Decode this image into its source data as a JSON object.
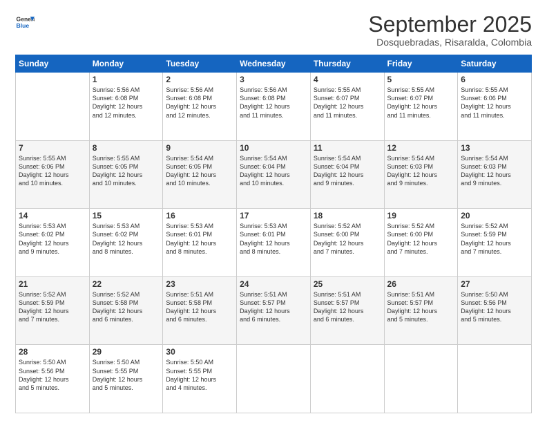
{
  "logo": {
    "line1": "General",
    "line2": "Blue"
  },
  "title": "September 2025",
  "subtitle": "Dosquebradas, Risaralda, Colombia",
  "days_header": [
    "Sunday",
    "Monday",
    "Tuesday",
    "Wednesday",
    "Thursday",
    "Friday",
    "Saturday"
  ],
  "weeks": [
    [
      {
        "num": "",
        "info": ""
      },
      {
        "num": "1",
        "info": "Sunrise: 5:56 AM\nSunset: 6:08 PM\nDaylight: 12 hours\nand 12 minutes."
      },
      {
        "num": "2",
        "info": "Sunrise: 5:56 AM\nSunset: 6:08 PM\nDaylight: 12 hours\nand 12 minutes."
      },
      {
        "num": "3",
        "info": "Sunrise: 5:56 AM\nSunset: 6:08 PM\nDaylight: 12 hours\nand 11 minutes."
      },
      {
        "num": "4",
        "info": "Sunrise: 5:55 AM\nSunset: 6:07 PM\nDaylight: 12 hours\nand 11 minutes."
      },
      {
        "num": "5",
        "info": "Sunrise: 5:55 AM\nSunset: 6:07 PM\nDaylight: 12 hours\nand 11 minutes."
      },
      {
        "num": "6",
        "info": "Sunrise: 5:55 AM\nSunset: 6:06 PM\nDaylight: 12 hours\nand 11 minutes."
      }
    ],
    [
      {
        "num": "7",
        "info": "Sunrise: 5:55 AM\nSunset: 6:06 PM\nDaylight: 12 hours\nand 10 minutes."
      },
      {
        "num": "8",
        "info": "Sunrise: 5:55 AM\nSunset: 6:05 PM\nDaylight: 12 hours\nand 10 minutes."
      },
      {
        "num": "9",
        "info": "Sunrise: 5:54 AM\nSunset: 6:05 PM\nDaylight: 12 hours\nand 10 minutes."
      },
      {
        "num": "10",
        "info": "Sunrise: 5:54 AM\nSunset: 6:04 PM\nDaylight: 12 hours\nand 10 minutes."
      },
      {
        "num": "11",
        "info": "Sunrise: 5:54 AM\nSunset: 6:04 PM\nDaylight: 12 hours\nand 9 minutes."
      },
      {
        "num": "12",
        "info": "Sunrise: 5:54 AM\nSunset: 6:03 PM\nDaylight: 12 hours\nand 9 minutes."
      },
      {
        "num": "13",
        "info": "Sunrise: 5:54 AM\nSunset: 6:03 PM\nDaylight: 12 hours\nand 9 minutes."
      }
    ],
    [
      {
        "num": "14",
        "info": "Sunrise: 5:53 AM\nSunset: 6:02 PM\nDaylight: 12 hours\nand 9 minutes."
      },
      {
        "num": "15",
        "info": "Sunrise: 5:53 AM\nSunset: 6:02 PM\nDaylight: 12 hours\nand 8 minutes."
      },
      {
        "num": "16",
        "info": "Sunrise: 5:53 AM\nSunset: 6:01 PM\nDaylight: 12 hours\nand 8 minutes."
      },
      {
        "num": "17",
        "info": "Sunrise: 5:53 AM\nSunset: 6:01 PM\nDaylight: 12 hours\nand 8 minutes."
      },
      {
        "num": "18",
        "info": "Sunrise: 5:52 AM\nSunset: 6:00 PM\nDaylight: 12 hours\nand 7 minutes."
      },
      {
        "num": "19",
        "info": "Sunrise: 5:52 AM\nSunset: 6:00 PM\nDaylight: 12 hours\nand 7 minutes."
      },
      {
        "num": "20",
        "info": "Sunrise: 5:52 AM\nSunset: 5:59 PM\nDaylight: 12 hours\nand 7 minutes."
      }
    ],
    [
      {
        "num": "21",
        "info": "Sunrise: 5:52 AM\nSunset: 5:59 PM\nDaylight: 12 hours\nand 7 minutes."
      },
      {
        "num": "22",
        "info": "Sunrise: 5:52 AM\nSunset: 5:58 PM\nDaylight: 12 hours\nand 6 minutes."
      },
      {
        "num": "23",
        "info": "Sunrise: 5:51 AM\nSunset: 5:58 PM\nDaylight: 12 hours\nand 6 minutes."
      },
      {
        "num": "24",
        "info": "Sunrise: 5:51 AM\nSunset: 5:57 PM\nDaylight: 12 hours\nand 6 minutes."
      },
      {
        "num": "25",
        "info": "Sunrise: 5:51 AM\nSunset: 5:57 PM\nDaylight: 12 hours\nand 6 minutes."
      },
      {
        "num": "26",
        "info": "Sunrise: 5:51 AM\nSunset: 5:57 PM\nDaylight: 12 hours\nand 5 minutes."
      },
      {
        "num": "27",
        "info": "Sunrise: 5:50 AM\nSunset: 5:56 PM\nDaylight: 12 hours\nand 5 minutes."
      }
    ],
    [
      {
        "num": "28",
        "info": "Sunrise: 5:50 AM\nSunset: 5:56 PM\nDaylight: 12 hours\nand 5 minutes."
      },
      {
        "num": "29",
        "info": "Sunrise: 5:50 AM\nSunset: 5:55 PM\nDaylight: 12 hours\nand 5 minutes."
      },
      {
        "num": "30",
        "info": "Sunrise: 5:50 AM\nSunset: 5:55 PM\nDaylight: 12 hours\nand 4 minutes."
      },
      {
        "num": "",
        "info": ""
      },
      {
        "num": "",
        "info": ""
      },
      {
        "num": "",
        "info": ""
      },
      {
        "num": "",
        "info": ""
      }
    ]
  ]
}
